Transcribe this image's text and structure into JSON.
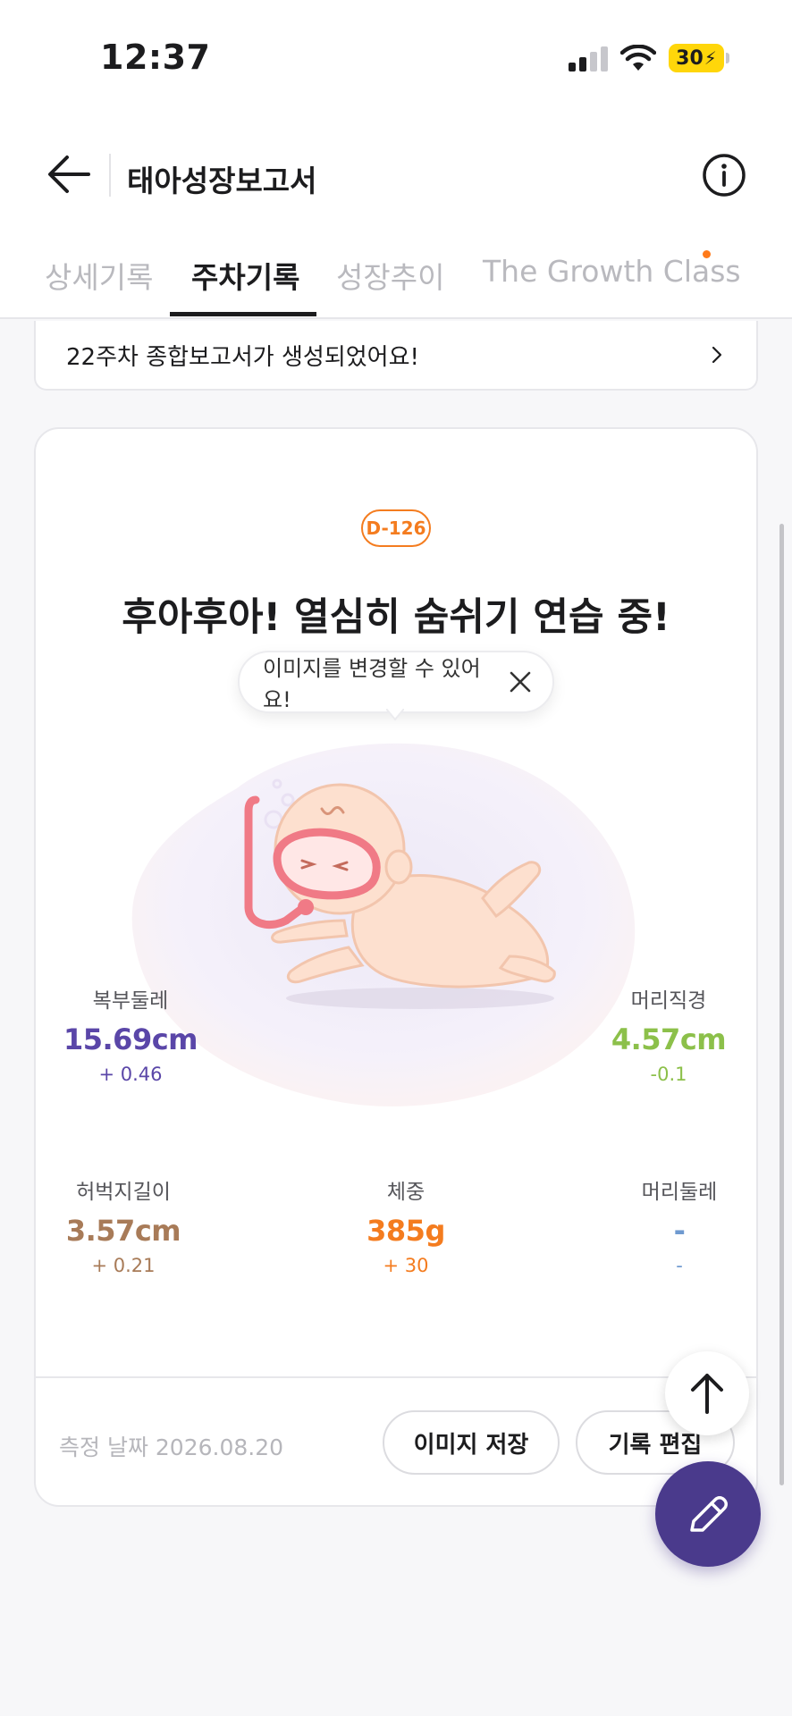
{
  "status_bar": {
    "time": "12:37",
    "battery": "30"
  },
  "header": {
    "title": "태아성장보고서"
  },
  "tabs": [
    {
      "label": "상세기록",
      "active": false
    },
    {
      "label": "주차기록",
      "active": true
    },
    {
      "label": "성장추이",
      "active": false
    },
    {
      "label": "The Growth Class",
      "active": false,
      "has_dot": true
    }
  ],
  "banner": {
    "text": "22주차 종합보고서가 생성되었어요!"
  },
  "card": {
    "dday": "D-126",
    "headline": "후아후아! 열심히 숨쉬기 연습 중!",
    "tooltip": "이미지를 변경할 수 있어요!",
    "metrics": {
      "abdomen": {
        "label": "복부둘레",
        "value": "15.69cm",
        "delta": "+ 0.46",
        "color": "#5a46a8"
      },
      "head_diameter": {
        "label": "머리직경",
        "value": "4.57cm",
        "delta": "-0.1",
        "color": "#8cc04a"
      },
      "femur": {
        "label": "허벅지길이",
        "value": "3.57cm",
        "delta": "+ 0.21",
        "color": "#a87b58"
      },
      "weight": {
        "label": "체중",
        "value": "385g",
        "delta": "+ 30",
        "color": "#f47c1f"
      },
      "head_circ": {
        "label": "머리둘레",
        "value": "-",
        "delta": "-",
        "color": "#6f9ad0"
      }
    },
    "measure_date": "측정 날짜 2026.08.20",
    "save_image_label": "이미지 저장",
    "edit_record_label": "기록 편집"
  }
}
